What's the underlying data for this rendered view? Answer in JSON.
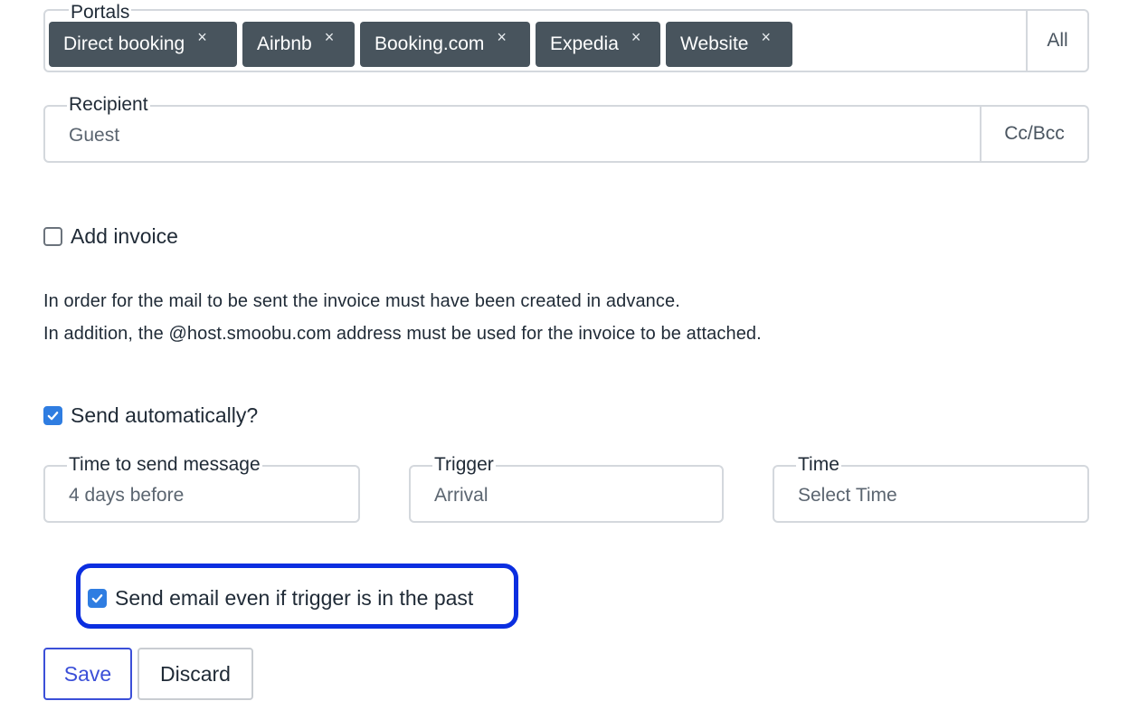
{
  "portals": {
    "legend": "Portals",
    "chips": [
      "Direct booking",
      "Airbnb",
      "Booking.com",
      "Expedia",
      "Website"
    ],
    "chip_remove_glyph": "×",
    "all_label": "All"
  },
  "recipient": {
    "legend": "Recipient",
    "value": "Guest",
    "ccbcc_label": "Cc/Bcc"
  },
  "add_invoice": {
    "label": "Add invoice",
    "checked": false
  },
  "info": {
    "line1": "In order for the mail to be sent the invoice must have been created in advance.",
    "line2": "In addition, the @host.smoobu.com address must be used for the invoice to be attached."
  },
  "send_automatically": {
    "label": "Send automatically?",
    "checked": true
  },
  "schedule": {
    "time_to_send": {
      "legend": "Time to send message",
      "value": "4 days before"
    },
    "trigger": {
      "legend": "Trigger",
      "value": "Arrival"
    },
    "time": {
      "legend": "Time",
      "value": "Select Time"
    }
  },
  "send_even_if_past": {
    "label": "Send email even if trigger is in the past",
    "checked": true
  },
  "buttons": {
    "save": "Save",
    "discard": "Discard"
  },
  "colors": {
    "chip_bg": "#48545d",
    "checkbox_checked": "#2f7de1",
    "highlight_border": "#0b2ee0",
    "save_accent": "#3b4fd8"
  }
}
